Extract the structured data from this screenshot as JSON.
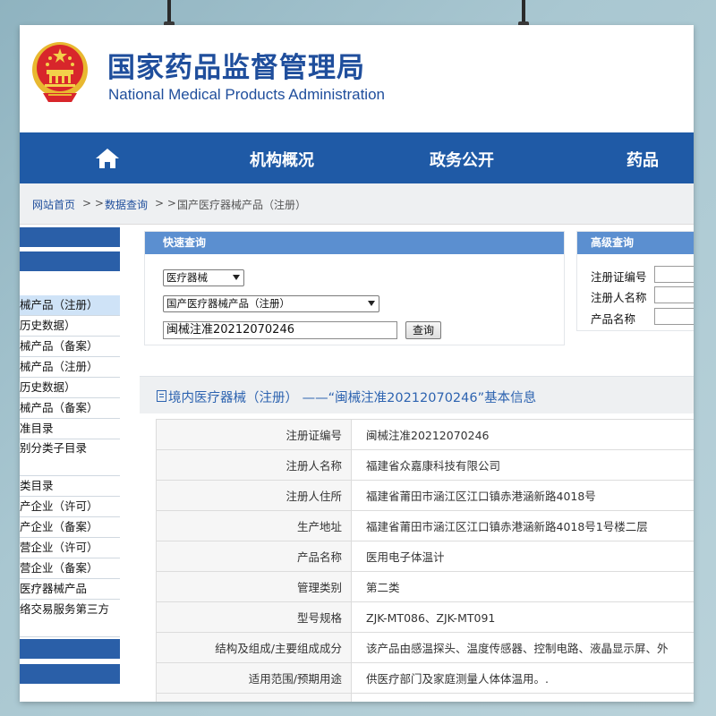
{
  "header": {
    "title_cn": "国家药品监督管理局",
    "title_en": "National Medical Products Administration"
  },
  "nav": {
    "home_icon": "home-icon",
    "items": [
      {
        "label": "机构概况"
      },
      {
        "label": "政务公开"
      },
      {
        "label": "药品"
      }
    ]
  },
  "breadcrumb": {
    "home": "网站首页",
    "sep1": " > > ",
    "data_query": "数据查询",
    "sep2": " > > ",
    "current": "国产医疗器械产品（注册）"
  },
  "sidebar": {
    "items": [
      {
        "label": "械产品（注册）"
      },
      {
        "label": "历史数据）"
      },
      {
        "label": "械产品（备案）"
      },
      {
        "label": "械产品（注册）"
      },
      {
        "label": "历史数据）"
      },
      {
        "label": "械产品（备案）"
      },
      {
        "label": "准目录"
      },
      {
        "label": "别分类子目录"
      },
      {
        "label": "类目录"
      },
      {
        "label": "产企业（许可）"
      },
      {
        "label": "产企业（备案）"
      },
      {
        "label": "营企业（许可）"
      },
      {
        "label": "营企业（备案）"
      },
      {
        "label": "医疗器械产品"
      },
      {
        "label": "络交易服务第三方"
      }
    ]
  },
  "quick_search": {
    "title": "快速查询",
    "category_select": "医疗器械",
    "subcategory_select": "国产医疗器械产品（注册）",
    "keyword_value": "闽械注准20212070246",
    "query_button": "查询"
  },
  "advanced_search": {
    "title": "高级查询",
    "fields": [
      {
        "label": "注册证编号"
      },
      {
        "label": "注册人名称"
      },
      {
        "label": "产品名称"
      }
    ]
  },
  "detail": {
    "heading": "境内医疗器械（注册）  ——“闽械注准20212070246”基本信息",
    "rows": [
      {
        "key": "注册证编号",
        "value": "闽械注准20212070246"
      },
      {
        "key": "注册人名称",
        "value": "福建省众嘉康科技有限公司"
      },
      {
        "key": "注册人住所",
        "value": "福建省莆田市涵江区江口镇赤港涵新路4018号"
      },
      {
        "key": "生产地址",
        "value": "福建省莆田市涵江区江口镇赤港涵新路4018号1号楼二层"
      },
      {
        "key": "产品名称",
        "value": "医用电子体温计"
      },
      {
        "key": "管理类别",
        "value": "第二类"
      },
      {
        "key": "型号规格",
        "value": "ZJK-MT086、ZJK-MT091"
      },
      {
        "key": "结构及组成/主要组成成分",
        "value": "该产品由感温探头、温度传感器、控制电路、液晶显示屏、外"
      },
      {
        "key": "适用范围/预期用途",
        "value": "供医疗部门及家庭测量人体体温用。."
      },
      {
        "key": "",
        "value": ""
      }
    ]
  },
  "colors": {
    "brand_blue": "#1f4e9c",
    "nav_blue": "#1f5aa6",
    "panel_blue": "#5b8fd0",
    "link_blue": "#2d63b0",
    "emblem_red": "#d8262b",
    "emblem_gold": "#e8b830"
  }
}
